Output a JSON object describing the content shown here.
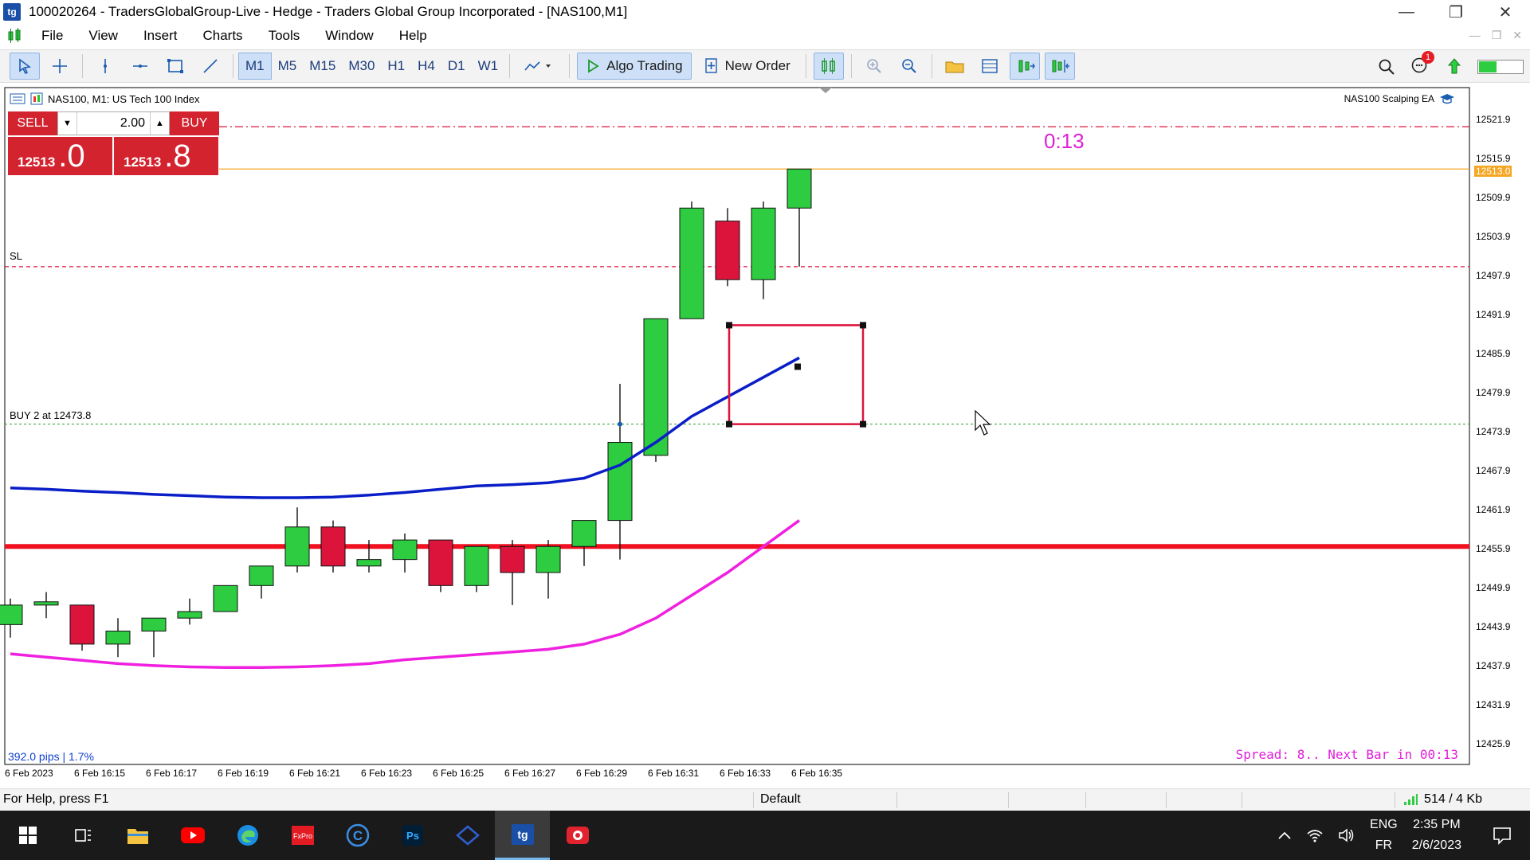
{
  "window": {
    "title": "100020264 - TradersGlobalGroup-Live - Hedge - Traders Global Group Incorporated - [NAS100,M1]",
    "app_icon_text": "tg"
  },
  "menu": {
    "items": [
      "File",
      "Insert",
      "Charts",
      "Tools",
      "Window",
      "Help"
    ],
    "view_label": "View"
  },
  "toolbar": {
    "timeframes": [
      "M1",
      "M5",
      "M15",
      "M30",
      "H1",
      "H4",
      "D1",
      "W1"
    ],
    "active_timeframe": "M1",
    "algo_trading_label": "Algo Trading",
    "new_order_label": "New Order",
    "notification_count": "1"
  },
  "chart": {
    "symbol_header": "NAS100, M1:  US Tech 100 Index",
    "ea_name": "NAS100 Scalping EA",
    "sl_label": "SL",
    "buy_line_label": "BUY 2 at 12473.8",
    "timer": "0:13",
    "spread_text": "Spread: 8.. Next Bar in 00:13",
    "pips_text": "392.0 pips | 1.7%",
    "current_price_label": "12513.0",
    "price_axis": [
      "12521.9",
      "12515.9",
      "12509.9",
      "12503.9",
      "12497.9",
      "12491.9",
      "12485.9",
      "12479.9",
      "12473.9",
      "12467.9",
      "12461.9",
      "12455.9",
      "12449.9",
      "12443.9",
      "12437.9",
      "12431.9",
      "12425.9"
    ],
    "time_axis": [
      "6 Feb 2023",
      "6 Feb 16:15",
      "6 Feb 16:17",
      "6 Feb 16:19",
      "6 Feb 16:21",
      "6 Feb 16:23",
      "6 Feb 16:25",
      "6 Feb 16:27",
      "6 Feb 16:29",
      "6 Feb 16:31",
      "6 Feb 16:33",
      "6 Feb 16:35"
    ],
    "colors": {
      "bull": "#2ecc40",
      "bear": "#dc143c",
      "ma_fast": "#0a1ec8",
      "ma_slow": "#f020e0",
      "support": "#f01020",
      "current": "#f5a623"
    }
  },
  "trade_panel": {
    "sell_label": "SELL",
    "buy_label": "BUY",
    "lot": "2.00",
    "sell_price_main": "12513",
    "sell_price_big": ".0",
    "buy_price_main": "12513",
    "buy_price_big": ".8"
  },
  "chart_data": {
    "type": "candlestick",
    "title": "NAS100, M1",
    "ylim": [
      12422,
      12526
    ],
    "candles": [
      {
        "t": "16:13",
        "o": 12443,
        "h": 12447,
        "l": 12441,
        "c": 12446
      },
      {
        "t": "16:14",
        "o": 12446,
        "h": 12448,
        "l": 12444,
        "c": 12446.5
      },
      {
        "t": "16:15",
        "o": 12446,
        "h": 12446,
        "l": 12439,
        "c": 12440
      },
      {
        "t": "16:16",
        "o": 12440,
        "h": 12444,
        "l": 12438,
        "c": 12442
      },
      {
        "t": "16:17",
        "o": 12442,
        "h": 12444,
        "l": 12438,
        "c": 12444
      },
      {
        "t": "16:18",
        "o": 12444,
        "h": 12447,
        "l": 12443,
        "c": 12445
      },
      {
        "t": "16:19",
        "o": 12445,
        "h": 12449,
        "l": 12445,
        "c": 12449
      },
      {
        "t": "16:20",
        "o": 12449,
        "h": 12452,
        "l": 12447,
        "c": 12452
      },
      {
        "t": "16:21",
        "o": 12452,
        "h": 12461,
        "l": 12451,
        "c": 12458
      },
      {
        "t": "16:22",
        "o": 12458,
        "h": 12459,
        "l": 12451,
        "c": 12452
      },
      {
        "t": "16:23",
        "o": 12452,
        "h": 12456,
        "l": 12451,
        "c": 12453
      },
      {
        "t": "16:24",
        "o": 12453,
        "h": 12457,
        "l": 12451,
        "c": 12456
      },
      {
        "t": "16:25",
        "o": 12456,
        "h": 12456,
        "l": 12448,
        "c": 12449
      },
      {
        "t": "16:26",
        "o": 12449,
        "h": 12455,
        "l": 12448,
        "c": 12455
      },
      {
        "t": "16:27",
        "o": 12455,
        "h": 12456,
        "l": 12446,
        "c": 12451
      },
      {
        "t": "16:28",
        "o": 12451,
        "h": 12456,
        "l": 12447,
        "c": 12455
      },
      {
        "t": "16:29",
        "o": 12455,
        "h": 12459,
        "l": 12452,
        "c": 12459
      },
      {
        "t": "16:30",
        "o": 12459,
        "h": 12480,
        "l": 12453,
        "c": 12471
      },
      {
        "t": "16:31",
        "o": 12469,
        "h": 12490,
        "l": 12468,
        "c": 12490
      },
      {
        "t": "16:32",
        "o": 12490,
        "h": 12508,
        "l": 12490,
        "c": 12507
      },
      {
        "t": "16:33",
        "o": 12505,
        "h": 12507,
        "l": 12495,
        "c": 12496
      },
      {
        "t": "16:34",
        "o": 12496,
        "h": 12508,
        "l": 12493,
        "c": 12507
      },
      {
        "t": "16:35",
        "o": 12507,
        "h": 12513,
        "l": 12498,
        "c": 12513
      }
    ],
    "ma_fast": [
      12464,
      12463.8,
      12463.5,
      12463.3,
      12463,
      12462.8,
      12462.6,
      12462.5,
      12462.5,
      12462.6,
      12462.9,
      12463.3,
      12463.8,
      12464.3,
      12464.5,
      12464.8,
      12465.5,
      12467.5,
      12471,
      12475,
      12478,
      12481,
      12484
    ],
    "ma_slow": [
      12438.5,
      12438,
      12437.5,
      12437,
      12436.7,
      12436.5,
      12436.4,
      12436.4,
      12436.5,
      12436.7,
      12437,
      12437.6,
      12438,
      12438.4,
      12438.8,
      12439.2,
      12440,
      12441.5,
      12444,
      12447.5,
      12451,
      12455,
      12459
    ],
    "support_level": 12455,
    "sl_level": 12498,
    "upper_level": 12519.5,
    "buy_entry": 12473.8,
    "current_price": 12513,
    "box": {
      "x_from": "16:33",
      "x_to": "16:37",
      "y_from": 12473.8,
      "y_to": 12489
    }
  },
  "status": {
    "help": "For Help, press F1",
    "profile": "Default",
    "network": "514 / 4 Kb"
  },
  "taskbar": {
    "lang_top": "ENG",
    "lang_bottom": "FR",
    "time": "2:35 PM",
    "date": "2/6/2023"
  }
}
